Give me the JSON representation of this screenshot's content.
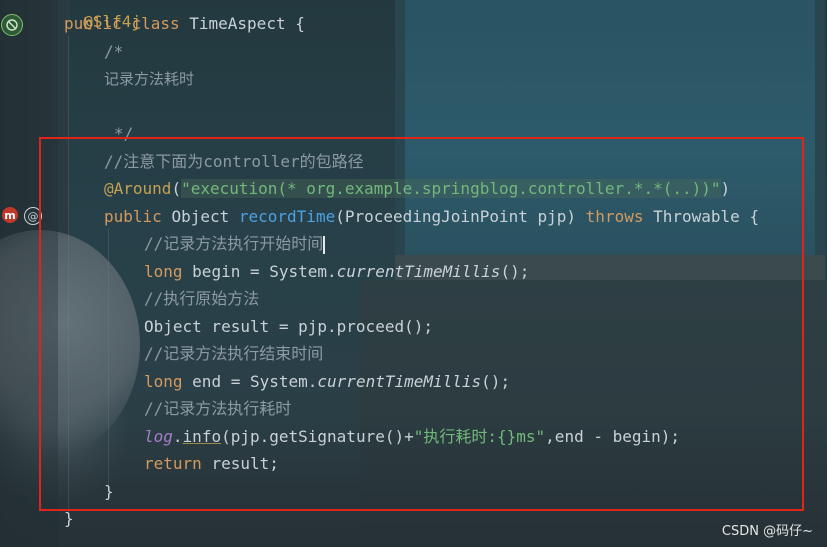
{
  "code": {
    "line_partial_top": "@Slf4j",
    "class_decl_kw1": "public",
    "class_decl_kw2": "class",
    "class_decl_name": "TimeAspect {",
    "comment_open": "/*",
    "comment_text": "记录方法耗时",
    "comment_close": "*/",
    "comment_pkg": "//注意下面为controller的包路径",
    "around_ann": "@Around",
    "around_paren_open": "(",
    "around_expr": "\"execution(* org.example.springblog.controller.*.*(..))\"",
    "around_paren_close": ")",
    "method_kw": "public",
    "method_type": "Object",
    "method_name": "recordTime",
    "method_params": "(ProceedingJoinPoint pjp)",
    "method_throws": "throws",
    "method_exc": "Throwable {",
    "cm_start": "//记录方法执行开始时间",
    "l_begin_kw": "long",
    "l_begin_rest": "begin = System.",
    "l_begin_call": "currentTimeMillis",
    "l_begin_end": "();",
    "cm_exec": "//执行原始方法",
    "l_result": "Object result = pjp.proceed();",
    "cm_end": "//记录方法执行结束时间",
    "l_end_kw": "long",
    "l_end_rest": "end = System.",
    "l_end_call": "currentTimeMillis",
    "l_end_end": "();",
    "cm_cost": "//记录方法执行耗时",
    "l_log_field": "log",
    "l_log_dot": ".",
    "l_log_info": "info",
    "l_log_mid": "(pjp.getSignature()+",
    "l_log_str": "\"执行耗时:{}ms\"",
    "l_log_tail": ",end - begin);",
    "l_return_kw": "return",
    "l_return_rest": "result;",
    "method_close": "}",
    "class_close": "}"
  },
  "gutter": {
    "aspect_icon": "aspect-icon",
    "method_icon": "m",
    "at_icon": "@"
  },
  "watermark": "CSDN @码仔~",
  "colors": {
    "highlight_border": "#e0241a",
    "keyword": "#d39a5f",
    "string": "#72b87c",
    "method": "#4ea1e0",
    "comment": "#8c9aa3"
  }
}
